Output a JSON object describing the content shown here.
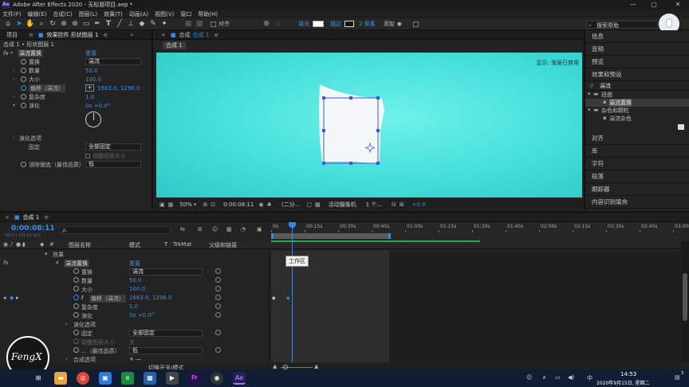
{
  "window": {
    "app_icon": "Ae",
    "title": "Adobe After Effects 2020 - 无标题项目.aep *",
    "min": "—",
    "max": "▢",
    "close": "✕"
  },
  "menu": [
    "文件(F)",
    "编辑(E)",
    "合成(C)",
    "图层(L)",
    "效果(T)",
    "动画(A)",
    "视图(V)",
    "窗口",
    "帮助(H)"
  ],
  "toolbar": {
    "align_label": "对齐",
    "fill_label": "填充",
    "stroke_label": "描边",
    "stroke_width": "2 像素",
    "add_label": "添加",
    "search_placeholder": "搜索帮助"
  },
  "left_panel": {
    "tab_project": "项目",
    "tab_effects": "效果控件 形状图层 1",
    "breadcrumb": "合成 1 • 形状图层 1",
    "fx_label": "fx",
    "effect_name": "湍流置换",
    "reset": "重置",
    "props": [
      {
        "label": "置换",
        "dropdown": "湍流"
      },
      {
        "label": "数量",
        "value": "50.0"
      },
      {
        "label": "大小",
        "value": "100.0"
      },
      {
        "label": "偏移（湍流）",
        "value": "1663.0, 1296.0"
      },
      {
        "label": "复杂度",
        "value": "1.0"
      },
      {
        "label": "演化",
        "value": "0x +0.0°"
      }
    ],
    "evolution_options": "演化选项",
    "pin_label": "固定",
    "pin_value": "全部固定",
    "resize_layer": "调整图层大小",
    "antialias_label": "消除锯齿（最佳品质）",
    "antialias_value": "低"
  },
  "comp_panel": {
    "tab_label": "合成",
    "tab_name": "合成 1",
    "sub_tab": "合成 1",
    "overlay_text": "显示: 渐层已禁用",
    "footer": {
      "zoom": "50%",
      "timecode": "0:00:08:11",
      "resolution": "（二分...",
      "camera": "活动摄像机",
      "views": "1 个...",
      "exposure": "+0.0"
    }
  },
  "right_panel": {
    "items_top": [
      "信息",
      "音频",
      "预览",
      "效果和预设"
    ],
    "search_value": "湍流",
    "tree": [
      {
        "label": "扭曲",
        "child": "湍流置换"
      },
      {
        "label": "杂色和颗粒",
        "child": "湍流杂色"
      }
    ],
    "items_bottom": [
      "对齐",
      "库",
      "字符",
      "段落",
      "跟踪器",
      "内容识别填充"
    ]
  },
  "timeline": {
    "tab_name": "合成 1",
    "timecode": "0:00:08:11",
    "timecode_sub": "00211 (25.00 fps)",
    "search_placeholder": "ρ.",
    "col_layer_name": "图层名称",
    "col_mode": "模式",
    "col_t": "T",
    "col_trkmat": "TrkMat",
    "col_parent": "父级和链接",
    "ruler": [
      "0s",
      "00:15s",
      "00:30s",
      "00:45s",
      "01:00s",
      "01:15s",
      "01:30s",
      "01:45s",
      "02:00s",
      "02:15s",
      "02:30s",
      "02:45s",
      "03:00s"
    ],
    "work_area_tip": "工作区",
    "rows": [
      {
        "label": "效果",
        "indent": 1
      },
      {
        "label": "湍流置换",
        "value": "重置",
        "indent": 2
      },
      {
        "label": "置换",
        "dropdown": "湍流",
        "indent": 3
      },
      {
        "label": "数量",
        "value": "50.0",
        "indent": 3
      },
      {
        "label": "大小",
        "value": "100.0",
        "indent": 3
      },
      {
        "label": "偏移（湍流）",
        "value": "1663.0, 1296.0",
        "indent": 3
      },
      {
        "label": "复杂度",
        "value": "1.0",
        "indent": 3
      },
      {
        "label": "演化",
        "value": "0x +0.0°",
        "indent": 3
      },
      {
        "label": "演化选项",
        "indent": 2
      },
      {
        "label": "固定",
        "dropdown": "全部固定",
        "indent": 3
      },
      {
        "label": "调整图层大小",
        "indent": 3
      },
      {
        "label": "...（最佳品质）",
        "dropdown": "低",
        "indent": 3
      },
      {
        "label": "合成选项",
        "value": "+ —",
        "indent": 2
      }
    ],
    "footer_toggle": "切换开关/模式",
    "watermark": "FengX"
  },
  "taskbar": {
    "time": "14:53",
    "date": "2020年9月15日, 星期二",
    "ime": "中",
    "notification": "3"
  },
  "colors": {
    "accent": "#2d8ceb",
    "canvas": "#45dfd9",
    "work_area": "#2aa84a",
    "ae_purple": "#9a7cff"
  }
}
